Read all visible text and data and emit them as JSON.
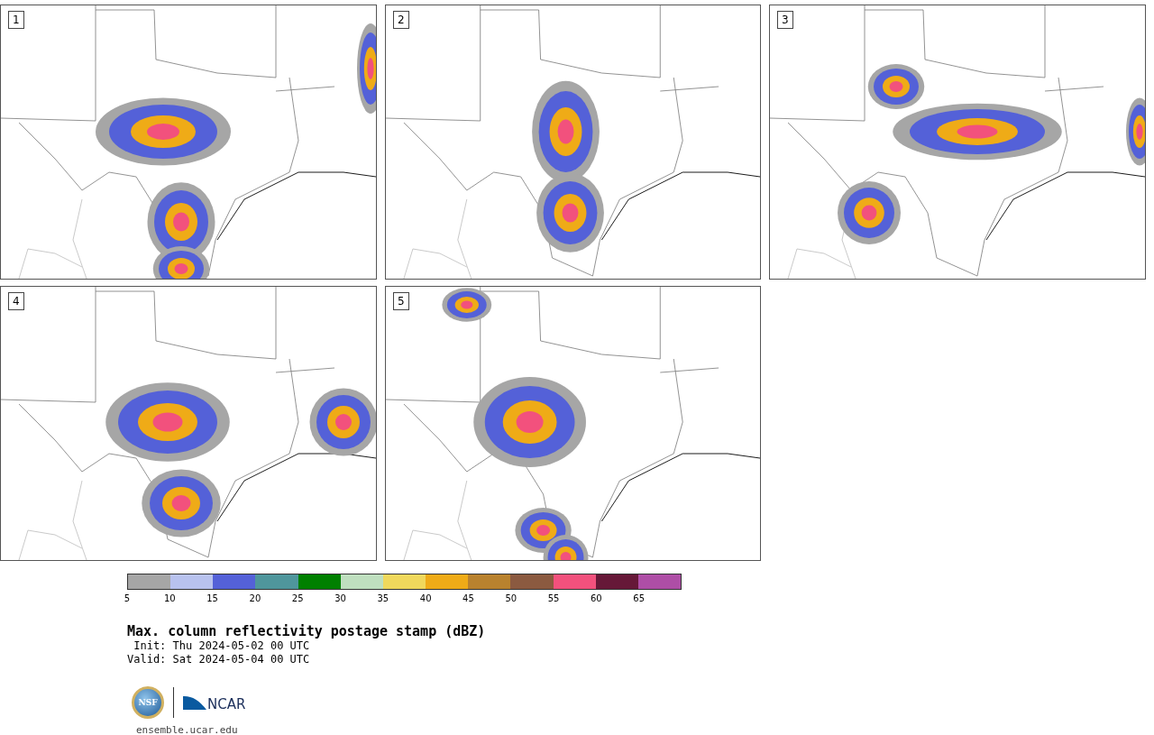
{
  "panels": [
    {
      "label": "1"
    },
    {
      "label": "2"
    },
    {
      "label": "3"
    },
    {
      "label": "4"
    },
    {
      "label": "5"
    }
  ],
  "colorbar": {
    "segments": [
      {
        "color": "#a6a6a6"
      },
      {
        "color": "#b8c2ee"
      },
      {
        "color": "#5461d8"
      },
      {
        "color": "#4f969c"
      },
      {
        "color": "#008000"
      },
      {
        "color": "#bfdfbf"
      },
      {
        "color": "#f0d85c"
      },
      {
        "color": "#efab17"
      },
      {
        "color": "#b9822e"
      },
      {
        "color": "#8b5a40"
      },
      {
        "color": "#f2517d"
      },
      {
        "color": "#661838"
      },
      {
        "color": "#ae4ea6"
      }
    ],
    "ticks": [
      "5",
      "10",
      "15",
      "20",
      "25",
      "30",
      "35",
      "40",
      "45",
      "50",
      "55",
      "60",
      "65"
    ]
  },
  "title": "Max. column reflectivity postage stamp (dBZ)",
  "init": " Init: Thu 2024-05-02 00 UTC",
  "valid": "Valid: Sat 2024-05-04 00 UTC",
  "logos": {
    "nsf": "NSF",
    "ncar": "NCAR"
  },
  "url": "ensemble.ucar.edu"
}
